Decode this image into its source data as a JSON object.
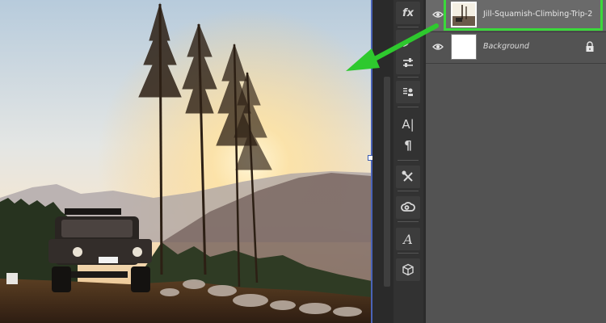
{
  "layers": [
    {
      "name": "Jill-Squamish-Climbing-Trip-2",
      "visible": true,
      "selected": true,
      "thumbnail": "photo"
    },
    {
      "name": "Background",
      "visible": true,
      "selected": false,
      "locked": true,
      "thumbnail": "white"
    }
  ],
  "tools": [
    "fx-icon",
    "brush-icon",
    "adjust-sliders-icon",
    "stamp-icon",
    "character-icon",
    "paragraph-icon",
    "tools-icon",
    "creative-cloud-icon",
    "glyphs-icon",
    "3d-cube-icon"
  ],
  "tool_glyphs": {
    "fx": "fx",
    "character": "A|",
    "paragraph": "¶",
    "glyphs": "A"
  },
  "colors": {
    "highlight": "#3bd93b",
    "arrow": "#2ec92e",
    "panel": "#535353",
    "selected_row": "#6a6a6a"
  }
}
